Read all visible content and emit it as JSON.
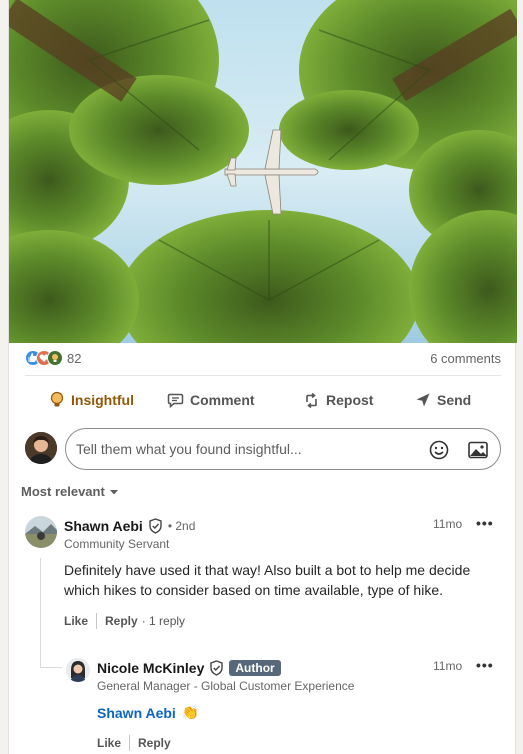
{
  "post": {
    "image_alt": "Airplane flying over palm trees",
    "reaction_count": "82",
    "reaction_icons": [
      "like-icon",
      "love-icon",
      "insightful-icon"
    ],
    "comments_count": "6 comments"
  },
  "actions": {
    "insightful": "Insightful",
    "comment": "Comment",
    "repost": "Repost",
    "send": "Send",
    "active_color": "#915907"
  },
  "comment_box": {
    "placeholder": "Tell them what you found insightful..."
  },
  "sort": {
    "label": "Most relevant"
  },
  "comments": [
    {
      "name": "Shawn Aebi",
      "degree": "• 2nd",
      "headline": "Community Servant",
      "time": "11mo",
      "text": "Definitely have used it that way! Also built a bot to help me decide which hikes to consider based on time available, type of hike.",
      "like": "Like",
      "reply": "Reply",
      "reply_count": "· 1 reply"
    }
  ],
  "reply": {
    "name": "Nicole McKinley",
    "badge": "Author",
    "headline": "General Manager - Global Customer Experience",
    "time": "11mo",
    "mention": "Shawn Aebi",
    "emoji": "👏",
    "like": "Like",
    "reply": "Reply"
  },
  "more_label": "•••",
  "colors": {
    "link": "#0a66c2",
    "author_badge": "#56687a"
  }
}
